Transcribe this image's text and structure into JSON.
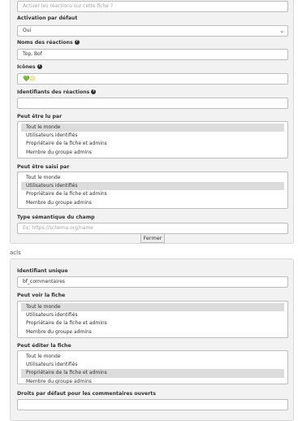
{
  "panel1": {
    "top_input_placeholder": "Activer les réactions sur cette fiche ?",
    "activation": {
      "label": "Activation par défaut",
      "value": "Oui"
    },
    "reaction_names": {
      "label": "Noms des réactions",
      "value": "Top, Bof"
    },
    "icons": {
      "label": "Icônes",
      "value_heart": "💚",
      "value_face": "😐"
    },
    "reaction_ids": {
      "label": "Identifiants des réactions",
      "value": ""
    },
    "readable_by": {
      "label": "Peut être lu par",
      "options": [
        "Tout le monde",
        "Utilisateurs identifiés",
        "Propriétaire de la fiche et admins",
        "Membre du groupe admins"
      ],
      "selected_index": 0
    },
    "editable_by": {
      "label": "Peut être saisi par",
      "options": [
        "Tout le monde",
        "Utilisateurs identifiés",
        "Propriétaire de la fiche et admins",
        "Membre du groupe admins"
      ],
      "selected_index": 1
    },
    "semantic_type": {
      "label": "Type sémantique du champ",
      "placeholder": "Ex: https://schema.org/name"
    },
    "close_label": "Fermer"
  },
  "section_acls": "acls",
  "panel2": {
    "unique_id": {
      "label": "Identifiant unique",
      "value": "bf_commentaires"
    },
    "can_view": {
      "label": "Peut voir la fiche",
      "options": [
        "Tout le monde",
        "Utilisateurs identifiés",
        "Propriétaire de la fiche et admins",
        "Membre du groupe admins"
      ],
      "selected_index": 0
    },
    "can_edit": {
      "label": "Peut éditer la fiche",
      "options": [
        "Tout le monde",
        "Utilisateurs identifiés",
        "Propriétaire de la fiche et admins",
        "Membre du groupe admins"
      ],
      "selected_index": 2
    },
    "default_comment_rights": {
      "label": "Droits par défaut pour les commentaires ouverts"
    }
  },
  "icons": {
    "help": "question-circle-icon",
    "chevron": "chevron-down-icon"
  },
  "colors": {
    "panel_bg": "#f2f2f2",
    "selected_option": "#dcdcdc",
    "border": "#bdbdbd"
  }
}
